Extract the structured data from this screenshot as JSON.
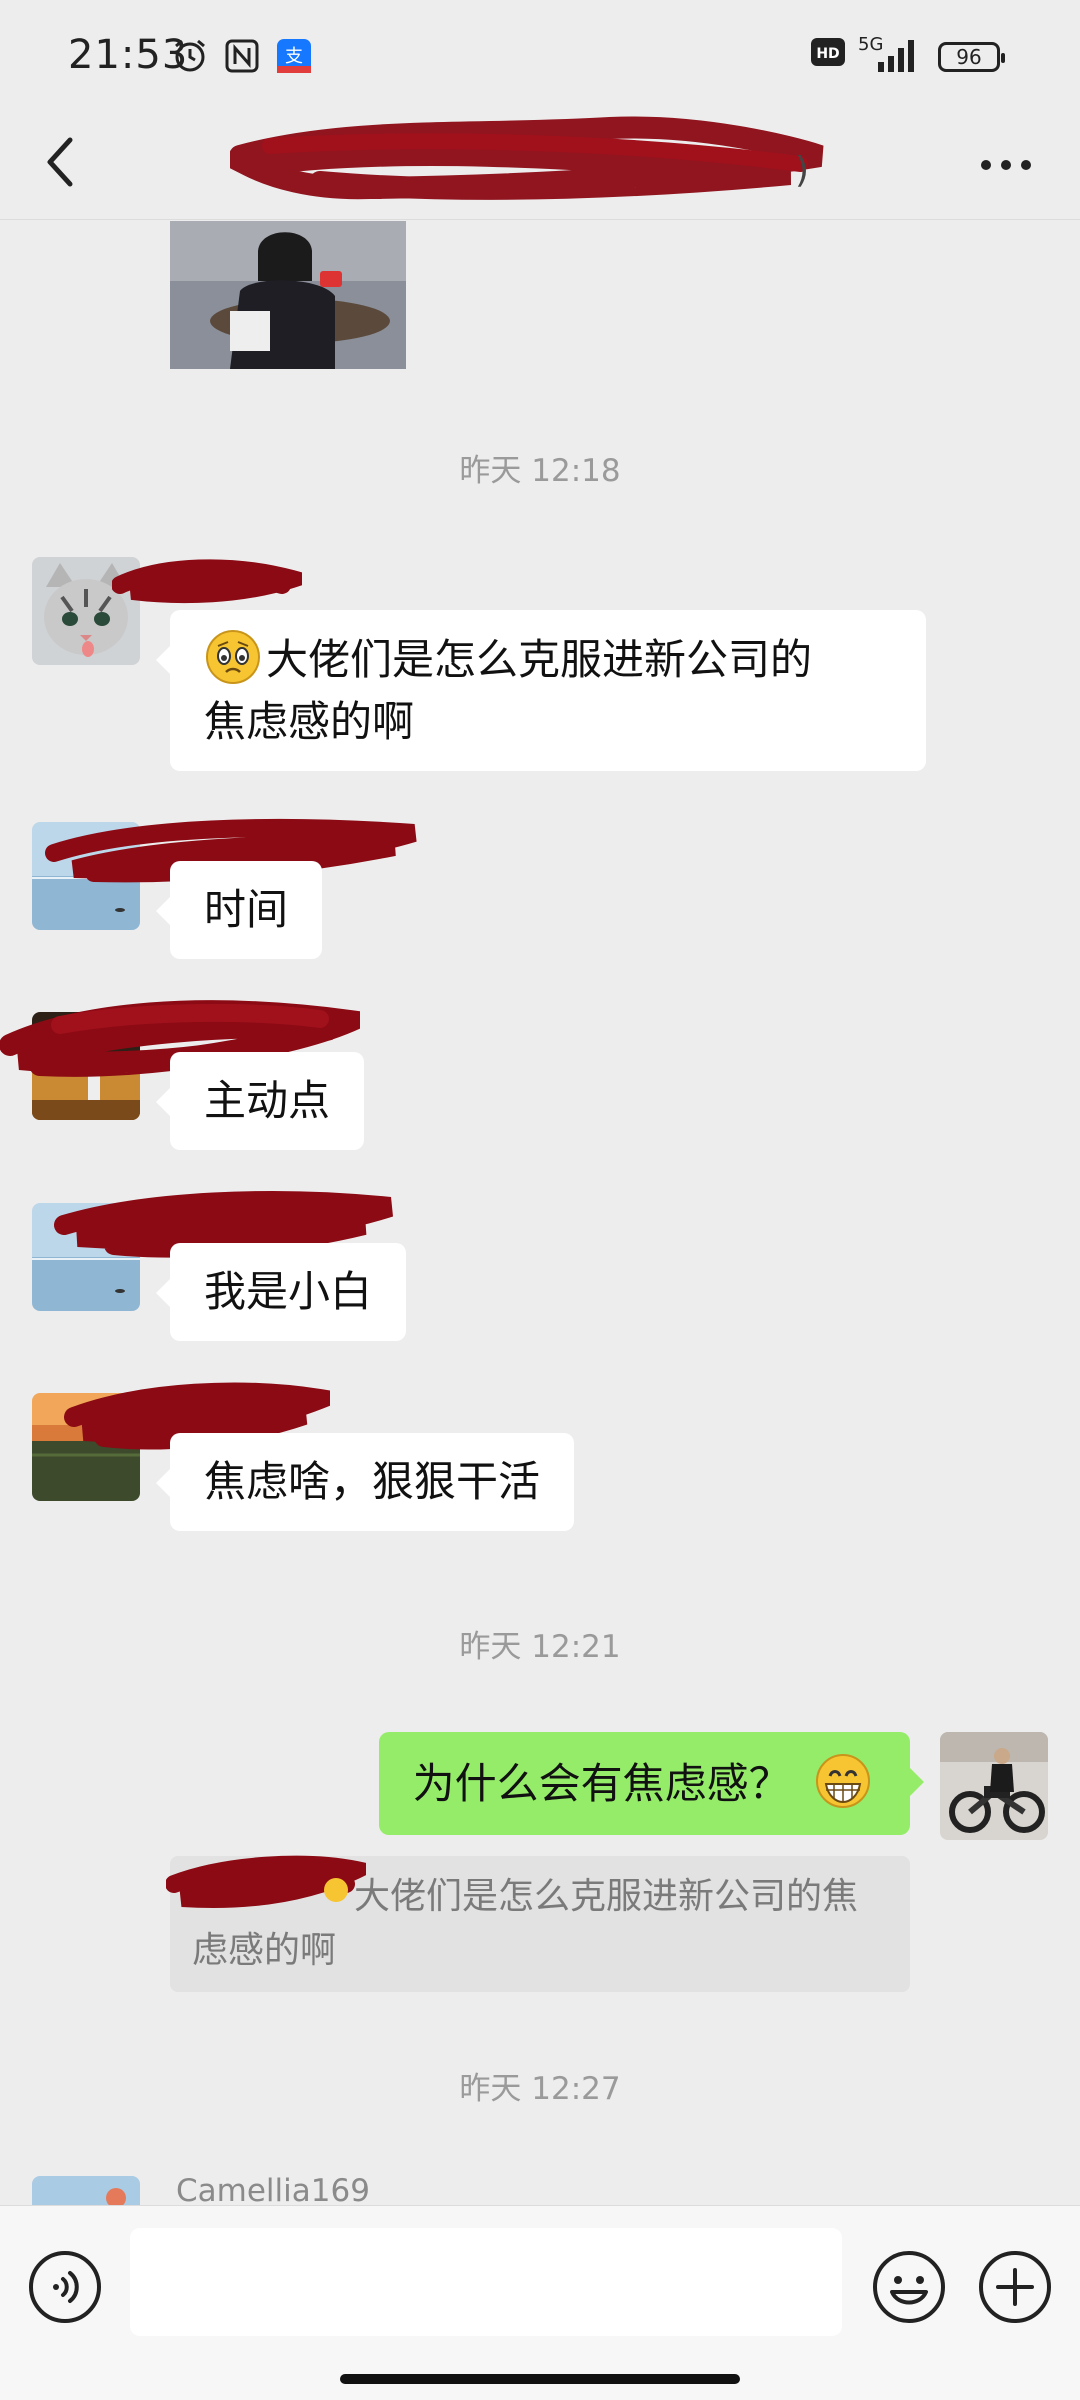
{
  "status_bar": {
    "time": "21:53",
    "network": "5G",
    "hd_badge": "HD",
    "battery": "96"
  },
  "header": {
    "title": "",
    "back_icon": "chevron-left-icon",
    "more_icon": "more-dots-icon"
  },
  "chat": {
    "timestamps": [
      "昨天 12:18",
      "昨天 12:21",
      "昨天 12:27"
    ],
    "messages": [
      {
        "text": "大佬们是怎么克服进新公司的焦虑感的啊",
        "line1": "大佬们是怎么克服进新公司的",
        "line2": "焦虑感的啊",
        "emoji": "worried-face-icon"
      },
      {
        "text": "时间"
      },
      {
        "text": "主动点"
      },
      {
        "text": "我是小白"
      },
      {
        "text": "焦虑啥，狠狠干活"
      }
    ],
    "my_message": {
      "text": "为什么会有焦虑感？",
      "emoji": "grinning-face-icon"
    },
    "quote": {
      "line1": "大佬们是怎么克服进新公司的焦",
      "line2": "虑感的啊"
    },
    "partial_nickname": "Camellia169"
  },
  "input_bar": {
    "value": "",
    "placeholder": ""
  },
  "colors": {
    "background": "#ededed",
    "my_bubble": "#95ec69",
    "other_bubble": "#ffffff",
    "redaction": "#8b0a14"
  }
}
